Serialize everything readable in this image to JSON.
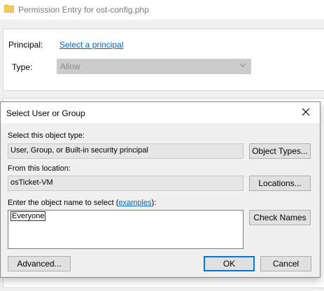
{
  "permission_entry": {
    "title": "Permission Entry for ost-config.php",
    "principal_label": "Principal:",
    "principal_link": "Select a principal",
    "type_label": "Type:",
    "type_value": "Allow"
  },
  "dialog": {
    "title": "Select User or Group",
    "object_type_label": "Select this object type:",
    "object_type_value": "User, Group, or Built-in security principal",
    "object_types_button": "Object Types...",
    "location_label": "From this location:",
    "location_value": "osTicket-VM",
    "locations_button": "Locations...",
    "enter_label_pre": "Enter the object name to select (",
    "examples_link": "examples",
    "enter_label_post": "):",
    "object_name_value": "Everyone",
    "check_names_button": "Check Names",
    "advanced_button": "Advanced...",
    "ok_button": "OK",
    "cancel_button": "Cancel"
  },
  "icons": {
    "folder": "folder-icon",
    "close": "close-icon",
    "chevron": "chevron-down-icon"
  },
  "colors": {
    "link": "#0066cc",
    "folder": "#f4c85a",
    "default_button_border": "#0078d7"
  }
}
